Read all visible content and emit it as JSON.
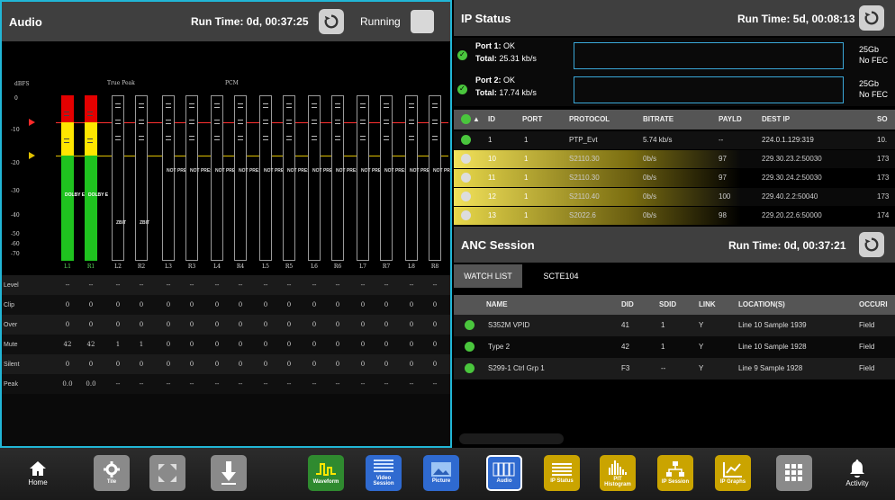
{
  "audio": {
    "title": "Audio",
    "run_time": "Run Time: 0d, 00:37:25",
    "state": "Running",
    "scale_label": "dBFS",
    "group_true_peak": "True Peak",
    "group_pcm": "PCM",
    "ticks": [
      "0",
      "-10",
      "-20",
      "-30",
      "-40",
      "-50",
      "-60",
      "-70"
    ],
    "channels": [
      {
        "label": "L1",
        "text": "DOLBY E",
        "kind": "dolby"
      },
      {
        "label": "R1",
        "text": "DOLBY E",
        "kind": "dolby"
      },
      {
        "label": "L2",
        "text": "ZBIT",
        "kind": "zbit"
      },
      {
        "label": "R2",
        "text": "ZBIT",
        "kind": "zbit"
      },
      {
        "label": "L3",
        "text": "NOT PRESENT",
        "kind": "np"
      },
      {
        "label": "R3",
        "text": "NOT PRESENT",
        "kind": "np"
      },
      {
        "label": "L4",
        "text": "NOT PRESENT",
        "kind": "np"
      },
      {
        "label": "R4",
        "text": "NOT PRESENT",
        "kind": "np"
      },
      {
        "label": "L5",
        "text": "NOT PRESENT",
        "kind": "np"
      },
      {
        "label": "R5",
        "text": "NOT PRESENT",
        "kind": "np"
      },
      {
        "label": "L6",
        "text": "NOT PRESENT",
        "kind": "np"
      },
      {
        "label": "R6",
        "text": "NOT PRESENT",
        "kind": "np"
      },
      {
        "label": "L7",
        "text": "NOT PRESENT",
        "kind": "np"
      },
      {
        "label": "R7",
        "text": "NOT PRESENT",
        "kind": "np"
      },
      {
        "label": "L8",
        "text": "NOT PRESENT",
        "kind": "np"
      },
      {
        "label": "R8",
        "text": "NOT PRESENT",
        "kind": "np"
      }
    ],
    "stats": [
      {
        "label": "Level",
        "values": [
          "--",
          "--",
          "--",
          "--",
          "--",
          "--",
          "--",
          "--",
          "--",
          "--",
          "--",
          "--",
          "--",
          "--",
          "--",
          "--"
        ]
      },
      {
        "label": "Clip",
        "values": [
          "0",
          "0",
          "0",
          "0",
          "0",
          "0",
          "0",
          "0",
          "0",
          "0",
          "0",
          "0",
          "0",
          "0",
          "0",
          "0"
        ]
      },
      {
        "label": "Over",
        "values": [
          "0",
          "0",
          "0",
          "0",
          "0",
          "0",
          "0",
          "0",
          "0",
          "0",
          "0",
          "0",
          "0",
          "0",
          "0",
          "0"
        ]
      },
      {
        "label": "Mute",
        "values": [
          "42",
          "42",
          "1",
          "1",
          "0",
          "0",
          "0",
          "0",
          "0",
          "0",
          "0",
          "0",
          "0",
          "0",
          "0",
          "0"
        ]
      },
      {
        "label": "Silent",
        "values": [
          "0",
          "0",
          "0",
          "0",
          "0",
          "0",
          "0",
          "0",
          "0",
          "0",
          "0",
          "0",
          "0",
          "0",
          "0",
          "0"
        ]
      },
      {
        "label": "Peak",
        "values": [
          "0.0",
          "0.0",
          "--",
          "--",
          "--",
          "--",
          "--",
          "--",
          "--",
          "--",
          "--",
          "--",
          "--",
          "--",
          "--",
          "--"
        ]
      }
    ]
  },
  "ip_status": {
    "title": "IP Status",
    "run_time": "Run Time: 5d, 00:08:13",
    "ports": [
      {
        "name": "Port 1:",
        "state": "OK",
        "total_label": "Total:",
        "total": "25.31 kb/s",
        "cap1": "25Gb",
        "cap2": "No FEC"
      },
      {
        "name": "Port 2:",
        "state": "OK",
        "total_label": "Total:",
        "total": "17.74 kb/s",
        "cap1": "25Gb",
        "cap2": "No FEC"
      }
    ],
    "columns": [
      "ID",
      "PORT",
      "PROTOCOL",
      "BITRATE",
      "PAYLD",
      "DEST IP",
      "SO"
    ],
    "rows": [
      {
        "id": "1",
        "port": "1",
        "protocol": "PTP_Evt",
        "bitrate": "5.74 kb/s",
        "payld": "--",
        "dest": "224.0.1.129:319",
        "src": "10.",
        "active": true
      },
      {
        "id": "10",
        "port": "1",
        "protocol": "S2110.30",
        "bitrate": "0b/s",
        "payld": "97",
        "dest": "229.30.23.2:50030",
        "src": "173",
        "active": false
      },
      {
        "id": "11",
        "port": "1",
        "protocol": "S2110.30",
        "bitrate": "0b/s",
        "payld": "97",
        "dest": "229.30.24.2:50030",
        "src": "173",
        "active": false
      },
      {
        "id": "12",
        "port": "1",
        "protocol": "S2110.40",
        "bitrate": "0b/s",
        "payld": "100",
        "dest": "229.40.2.2:50040",
        "src": "173",
        "active": false
      },
      {
        "id": "13",
        "port": "1",
        "protocol": "S2022.6",
        "bitrate": "0b/s",
        "payld": "98",
        "dest": "229.20.22.6:50000",
        "src": "174",
        "active": false
      }
    ]
  },
  "anc": {
    "title": "ANC Session",
    "run_time": "Run Time: 0d, 00:37:21",
    "tabs": [
      "WATCH LIST",
      "SCTE104"
    ],
    "columns": [
      "NAME",
      "DID",
      "SDID",
      "LINK",
      "LOCATION(S)",
      "OCCURI"
    ],
    "rows": [
      {
        "name": "S352M VPID",
        "did": "41",
        "sdid": "1",
        "link": "Y",
        "loc": "Line 10 Sample 1939",
        "occ": "Field"
      },
      {
        "name": "Type 2",
        "did": "42",
        "sdid": "1",
        "link": "Y",
        "loc": "Line 10 Sample 1928",
        "occ": "Field"
      },
      {
        "name": "S299-1 Ctrl Grp 1",
        "did": "F3",
        "sdid": "--",
        "link": "Y",
        "loc": "Line 9 Sample 1928",
        "occ": "Field"
      }
    ]
  },
  "taskbar": {
    "home": "Home",
    "tile": "Tile",
    "waveform": "Waveform",
    "video_session": "Video Session",
    "picture": "Picture",
    "audio": "Audio",
    "ip_status": "IP Status",
    "pit_histogram": "PIT Histogram",
    "ip_session": "IP Session",
    "ip_graphs": "IP Graphs",
    "activity": "Activity"
  },
  "colors": {
    "accent_border": "#21b6d6",
    "ok_green": "#4ac63d",
    "meter_red": "#e40000",
    "meter_yellow": "#ffe600",
    "meter_green": "#1fc21f",
    "taskbar_blue": "#2f6ad0",
    "taskbar_yellow": "#caa400"
  }
}
